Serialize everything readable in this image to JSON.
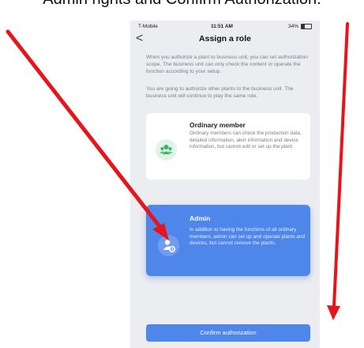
{
  "caption": "Admin rights and Confirm Authorization.",
  "status_bar": {
    "carrier": "T-Mobile",
    "time": "11:51 AM",
    "battery": "34%"
  },
  "nav": {
    "back_label": "<",
    "title": "Assign a role"
  },
  "description": {
    "para1": "When you authorize a plant to business unit, you can set authorization scope. The business unit can only check the content or operate the function according to your setup.",
    "para2": "You are going to authorize other plants to the business unit. The business unit will continue to play the same role."
  },
  "roles": [
    {
      "title": "Ordinary member",
      "text": "Ordinary members can check the production data, detailed information, alert information and device information, but cannot edit or set up the plant.",
      "icon": "members-icon",
      "selected": false
    },
    {
      "title": "Admin",
      "text": "In addition to having the functions of all ordinary members, admin can set up and operate plants and devices, but cannot remove the plants.",
      "icon": "admin-gear-icon",
      "selected": true
    }
  ],
  "confirm_label": "Confirm authorization",
  "colors": {
    "primary": "#4f86ea",
    "arrow": "#e8141b",
    "background": "#ecedf0"
  }
}
